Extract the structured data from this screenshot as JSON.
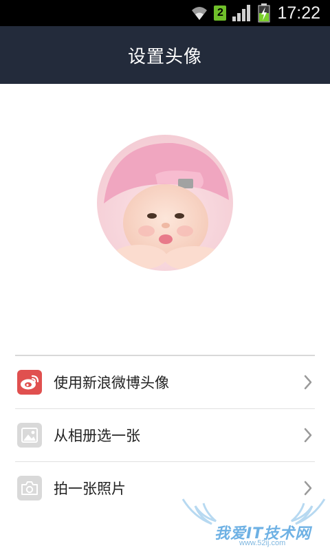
{
  "status_bar": {
    "time": "17:22",
    "sim_badge": "2",
    "icons": [
      "wifi-icon",
      "signal-icon",
      "battery-charging-icon"
    ]
  },
  "header": {
    "title": "设置头像"
  },
  "avatar": {
    "description_icon": "profile-photo"
  },
  "options": [
    {
      "label": "使用新浪微博头像",
      "icon": "weibo-icon",
      "icon_bg": "#e0504f"
    },
    {
      "label": "从相册选一张",
      "icon": "album-icon",
      "icon_bg": "#d9d9d9"
    },
    {
      "label": "拍一张照片",
      "icon": "camera-icon",
      "icon_bg": "#d9d9d9"
    }
  ],
  "watermark": {
    "text": "我爱IT技术网",
    "sub": "www.52ij.com"
  },
  "colors": {
    "titlebar": "#232b3b",
    "statusbar": "#000000",
    "weibo": "#e0504f"
  }
}
